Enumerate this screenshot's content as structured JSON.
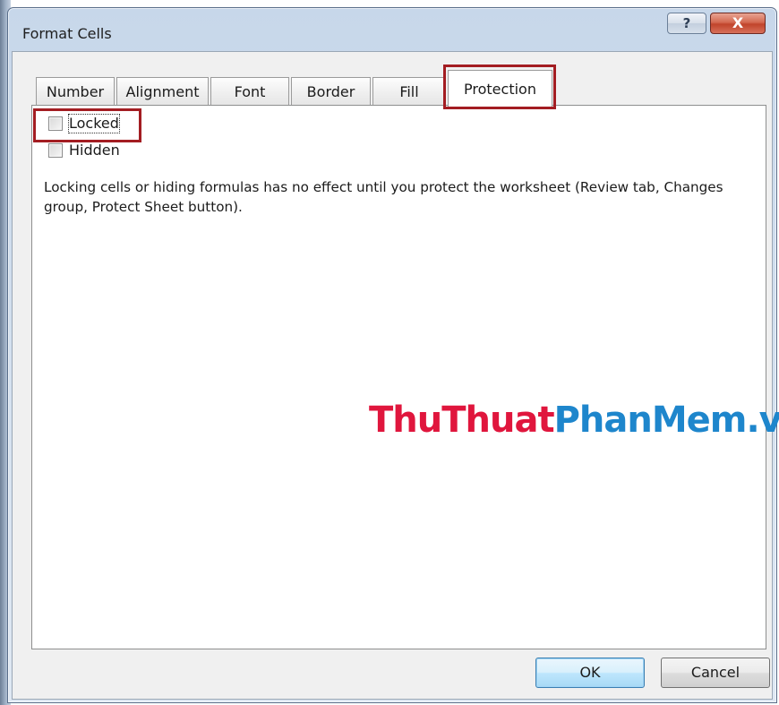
{
  "window": {
    "title": "Format Cells",
    "help_label": "?",
    "close_label": "X"
  },
  "tabs": [
    {
      "label": "Number",
      "active": false
    },
    {
      "label": "Alignment",
      "active": false
    },
    {
      "label": "Font",
      "active": false
    },
    {
      "label": "Border",
      "active": false
    },
    {
      "label": "Fill",
      "active": false
    },
    {
      "label": "Protection",
      "active": true
    }
  ],
  "protection": {
    "locked": {
      "label": "Locked",
      "checked": false
    },
    "hidden": {
      "label": "Hidden",
      "checked": false
    },
    "description": "Locking cells or hiding formulas has no effect until you protect the worksheet (Review tab, Changes group, Protect Sheet button)."
  },
  "watermark": {
    "part1": "ThuThuat",
    "part2": "PhanMem",
    "part3": ".vn",
    "color1": "#e0163d",
    "color2": "#1e86cc"
  },
  "buttons": {
    "ok_label": "OK",
    "cancel_label": "Cancel"
  },
  "colors": {
    "highlight_box": "#a31d22"
  }
}
